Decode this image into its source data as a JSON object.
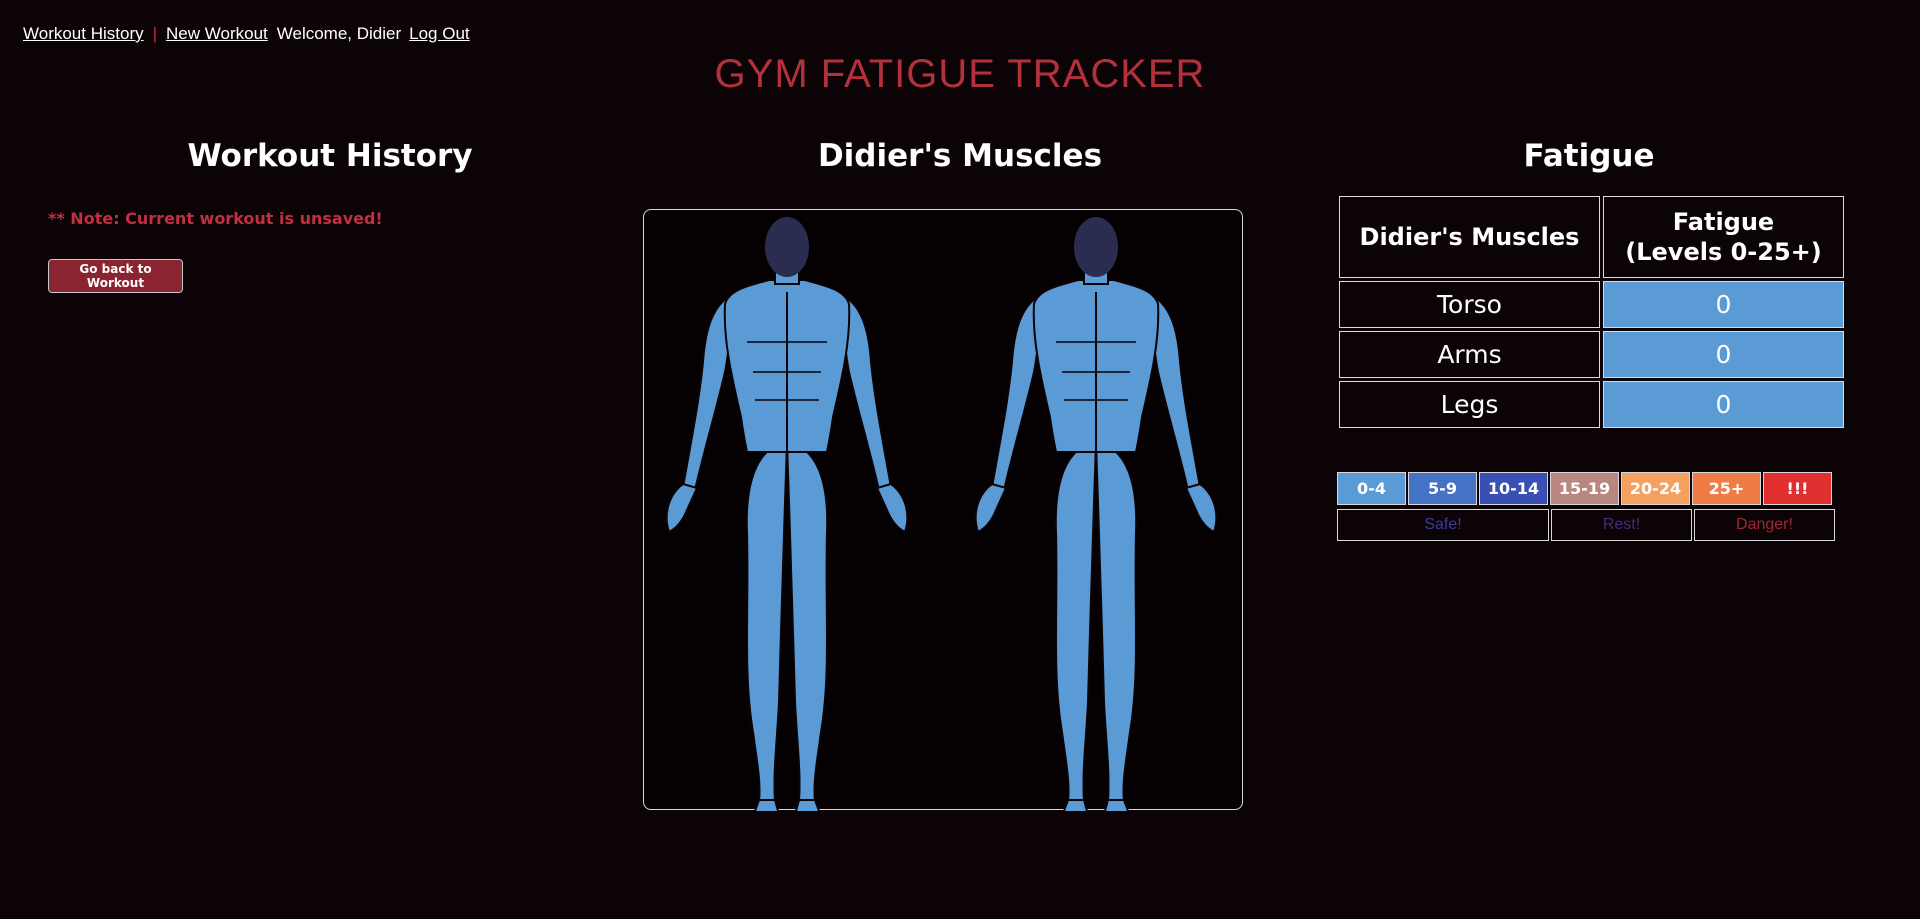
{
  "nav": {
    "history_link": "Workout History",
    "separator": "|",
    "new_workout_link": "New Workout",
    "welcome": "Welcome, Didier",
    "logout_link": "Log Out"
  },
  "app_title": "GYM FATIGUE TRACKER",
  "history": {
    "heading": "Workout History",
    "note": "** Note: Current workout is unsaved!",
    "back_button": "Go back to Workout"
  },
  "muscles": {
    "heading": "Didier's Muscles",
    "figure_icons": [
      "front-body-icon",
      "back-body-icon"
    ]
  },
  "fatigue": {
    "heading": "Fatigue",
    "col_muscle": "Didier's Muscles",
    "col_fatigue_line1": "Fatigue",
    "col_fatigue_line2": "(Levels 0-25+)",
    "rows": [
      {
        "muscle": "Torso",
        "value": "0"
      },
      {
        "muscle": "Arms",
        "value": "0"
      },
      {
        "muscle": "Legs",
        "value": "0"
      }
    ]
  },
  "legend": {
    "levels": [
      {
        "label": "0-4",
        "color": "#5b9bd5"
      },
      {
        "label": "5-9",
        "color": "#4472c4"
      },
      {
        "label": "10-14",
        "color": "#3a4fb4"
      },
      {
        "label": "15-19",
        "color": "#b98680"
      },
      {
        "label": "20-24",
        "color": "#f4a060"
      },
      {
        "label": "25+",
        "color": "#ef7b45"
      },
      {
        "label": "!!!",
        "color": "#e02f2f"
      }
    ],
    "labels": [
      {
        "text": "Safe!",
        "color": "#3f3aa0"
      },
      {
        "text": "Rest!",
        "color": "#4a2a7a"
      },
      {
        "text": "Danger!",
        "color": "#a02830"
      }
    ]
  },
  "colors": {
    "background": "#0b0306",
    "title_red": "#b3313d",
    "muscle_blue": "#5b9bd5",
    "head_navy": "#2b2d50"
  }
}
